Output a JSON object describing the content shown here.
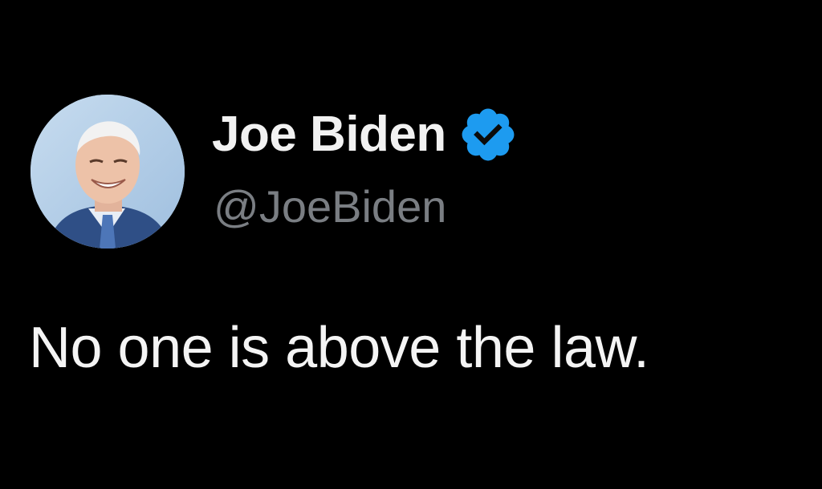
{
  "tweet": {
    "author": {
      "display_name": "Joe Biden",
      "handle": "@JoeBiden",
      "verified": true,
      "avatar_icon": "profile-photo"
    },
    "text": "No one is above the law."
  },
  "colors": {
    "background": "#000000",
    "name_text": "#f2f2f2",
    "handle_text": "#7a7e83",
    "body_text": "#f4f4f4",
    "verified_badge": "#1d9bf0"
  }
}
